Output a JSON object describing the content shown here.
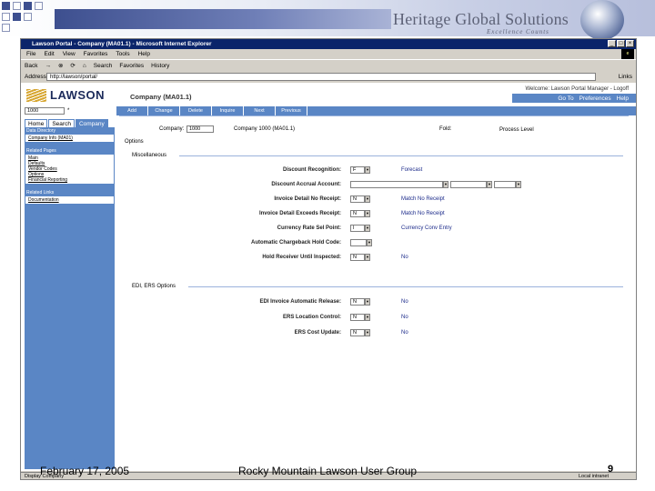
{
  "slide": {
    "brand": "Heritage Global Solutions",
    "brand_sub": "Excellence Counts",
    "footer_date": "February 17, 2005",
    "footer_center": "Rocky Mountain Lawson User Group",
    "page_number": "9"
  },
  "browser": {
    "title": "Lawson Portal - Company (MA01.1) - Microsoft Internet Explorer",
    "menu": [
      "File",
      "Edit",
      "View",
      "Favorites",
      "Tools",
      "Help"
    ],
    "toolbar": [
      "Back",
      "→",
      "⊗",
      "⟳",
      "⌂",
      "Search",
      "Favorites",
      "History"
    ],
    "address_label": "Address",
    "address_value": "http://lawson/portal/",
    "links_label": "Links",
    "status_left": "Display Company",
    "status_right": "Local intranet"
  },
  "app": {
    "logo_text": "LAWSON",
    "page_title": "Company (MA01.1)",
    "welcome": "Welcome: Lawson Portal Manager - Logoff",
    "goto_links": [
      "Go To",
      "Preferences",
      "Help"
    ],
    "nav_buttons": [
      "Add",
      "Change",
      "Delete",
      "Inquire",
      "Next",
      "Previous"
    ],
    "search_value": "1000",
    "search_star": "*",
    "tabs": [
      "Home",
      "Search",
      "Company"
    ],
    "left_sections": [
      {
        "head": "Data Directory",
        "items": [
          "Company Info (MA01)"
        ]
      },
      {
        "head": "Related Pages",
        "items": [
          "Main",
          "Defaults",
          "Vendor Codes",
          "Options",
          "Financial Reporting"
        ]
      },
      {
        "head": "Related Links",
        "items": [
          "Documentation"
        ]
      }
    ],
    "company_label": "Company:",
    "company_value": "1000",
    "company_name": "Company 1000 (MA01.1)",
    "fold_label": "Fold:",
    "process_level_label": "Process Level",
    "options_label": "Options",
    "misc_section": "Miscellaneous",
    "edi_section": "EDI, ERS Options",
    "misc_rows": [
      {
        "label": "Discount Recognition:",
        "value": "F",
        "desc": "Forecast"
      },
      {
        "label": "Discount Accrual Account:",
        "value": "",
        "desc": ""
      },
      {
        "label": "Invoice Detail No Receipt:",
        "value": "N",
        "desc": "Match No Receipt"
      },
      {
        "label": "Invoice Detail Exceeds Receipt:",
        "value": "N",
        "desc": "Match No Receipt"
      },
      {
        "label": "Currency Rate Sel Point:",
        "value": "I",
        "desc": "Currency Conv Entry"
      },
      {
        "label": "Automatic Chargeback Hold Code:",
        "value": "",
        "desc": ""
      },
      {
        "label": "Hold Receiver Until Inspected:",
        "value": "N",
        "desc": "No"
      }
    ],
    "edi_rows": [
      {
        "label": "EDI Invoice Automatic Release:",
        "value": "N",
        "desc": "No"
      },
      {
        "label": "ERS Location Control:",
        "value": "N",
        "desc": "No"
      },
      {
        "label": "ERS Cost Update:",
        "value": "N",
        "desc": "No"
      }
    ]
  }
}
